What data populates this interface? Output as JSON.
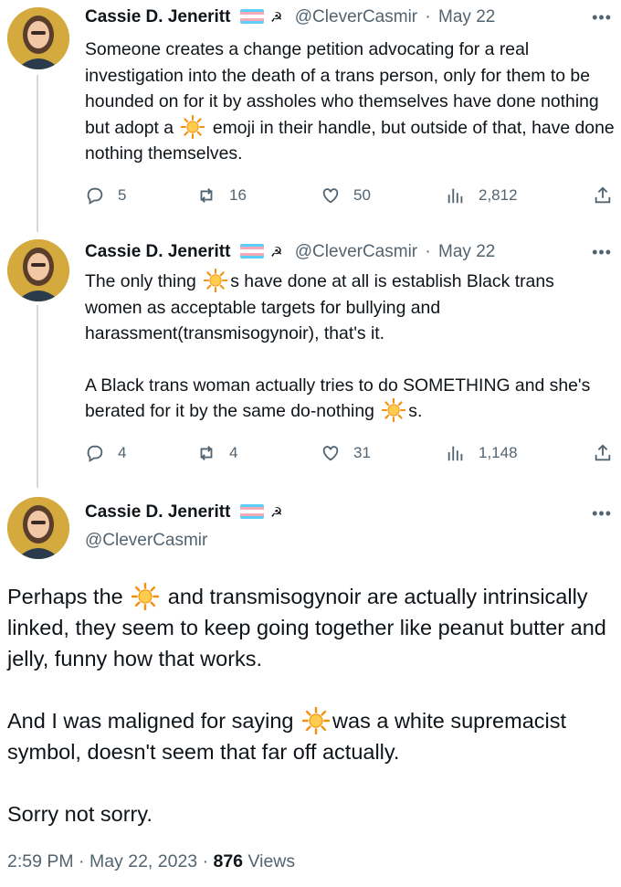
{
  "thread": [
    {
      "author": "Cassie D. Jeneritt",
      "handle": "@CleverCasmir",
      "date": "May 22",
      "paragraphs": [
        [
          "Someone creates a change petition advocating for a real investigation into the death of a trans person, only for them to be hounded on for it by assholes who themselves have done nothing but adopt a ",
          "sun",
          " emoji in their handle, but outside of that, have done nothing themselves."
        ]
      ],
      "replies": "5",
      "retweets": "16",
      "likes": "50",
      "views": "2,812"
    },
    {
      "author": "Cassie D. Jeneritt",
      "handle": "@CleverCasmir",
      "date": "May 22",
      "paragraphs": [
        [
          "The only thing ",
          "sun",
          "s have done at all is establish Black trans women as acceptable targets for bullying and harassment(transmisogynoir), that's it."
        ],
        [
          "A Black trans woman actually tries to do SOMETHING and she's berated for it by the same do-nothing ",
          "sun",
          "s."
        ]
      ],
      "replies": "4",
      "retweets": "4",
      "likes": "31",
      "views": "1,148"
    }
  ],
  "main": {
    "author": "Cassie D. Jeneritt",
    "handle": "@CleverCasmir",
    "paragraphs": [
      [
        "Perhaps the ",
        "sun",
        " and transmisogynoir are actually intrinsically linked, they seem to keep going together like peanut butter and jelly, funny how that works."
      ],
      [
        "And I was maligned for saying ",
        "sun",
        "was a white supremacist symbol, doesn't seem that far off actually."
      ],
      [
        "Sorry not sorry."
      ]
    ],
    "time": "2:59 PM",
    "full_date": "May 22, 2023",
    "views_count": "876",
    "views_label": "Views"
  },
  "ui": {
    "separator": "·",
    "more": "•••",
    "sickle": "☭"
  },
  "icons": {
    "sun": "sun-emoji-icon",
    "reply": "reply-icon",
    "retweet": "retweet-icon",
    "like": "like-icon",
    "views": "views-icon",
    "share": "share-icon"
  },
  "colors": {
    "text": "#0f1419",
    "secondary": "#536471",
    "thread_line": "#cfd9de",
    "flag_blue": "#5bcefa",
    "flag_pink": "#f5a9b8",
    "flag_white": "#ffffff",
    "sun_fill": "#ffcc4d",
    "sun_stroke": "#f4900c"
  }
}
